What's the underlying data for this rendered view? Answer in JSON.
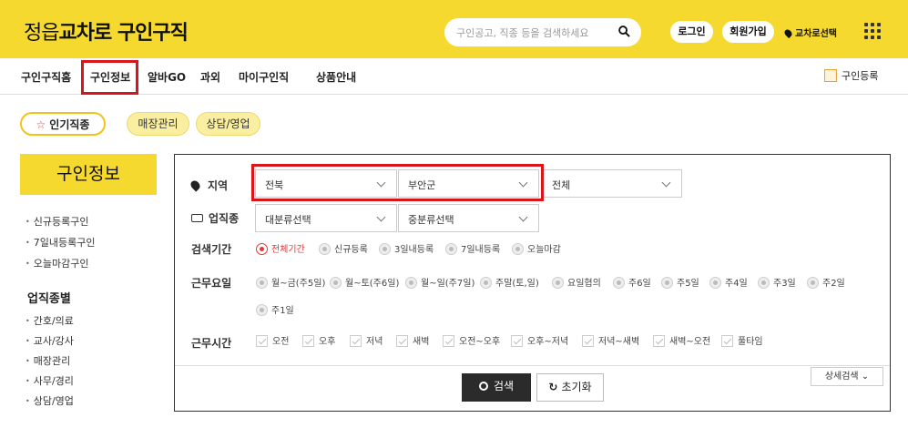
{
  "header": {
    "brand_prefix": "정읍",
    "brand_bold": "교차로",
    "brand_suffix": " 구인구직",
    "search_placeholder": "구인공고, 직종 등을 검색하세요",
    "login": "로그인",
    "signup": "회원가입",
    "location": "교차로선택",
    "brand_color": "#f6d92f"
  },
  "nav": {
    "items": [
      "구인구직홈",
      "구인정보",
      "알바GO",
      "과외",
      "마이구인직",
      "상품안내"
    ],
    "active": "구인정보",
    "register": "구인등록"
  },
  "chips": {
    "popular": "인기직종",
    "c1": "매장관리",
    "c2": "상담/영업"
  },
  "sidebar": {
    "title": "구인정보",
    "links": [
      "신규등록구인",
      "7일내등록구인",
      "오늘마감구인"
    ],
    "section": "업직종별",
    "categories": [
      "간호/의료",
      "교사/강사",
      "매장관리",
      "사무/경리",
      "상담/영업"
    ]
  },
  "filter": {
    "region_label": "지역",
    "region_sel1": "전북",
    "region_sel2": "부안군",
    "region_sel3": "전체",
    "job_label": "업직종",
    "job_sel1": "대분류선택",
    "job_sel2": "중분류선택",
    "period_label": "검색기간",
    "period_opts": [
      "전체기간",
      "신규등록",
      "3일내등록",
      "7일내등록",
      "오늘마감"
    ],
    "period_selected": "전체기간",
    "days_label": "근무요일",
    "days_opts": [
      "월~금(주5일)",
      "월~토(주6일)",
      "월~일(주7일)",
      "주말(토,일)",
      "요일협의",
      "주6일",
      "주5일",
      "주4일",
      "주3일",
      "주2일",
      "주1일"
    ],
    "time_label": "근무시간",
    "time_opts": [
      "오전",
      "오후",
      "저녁",
      "새벽",
      "오전~오후",
      "오후~저녁",
      "저녁~새벽",
      "새벽~오전",
      "풀타임"
    ],
    "detail": "상세검색 ⌄",
    "search_btn": "검색",
    "reset_btn": "초기화"
  }
}
